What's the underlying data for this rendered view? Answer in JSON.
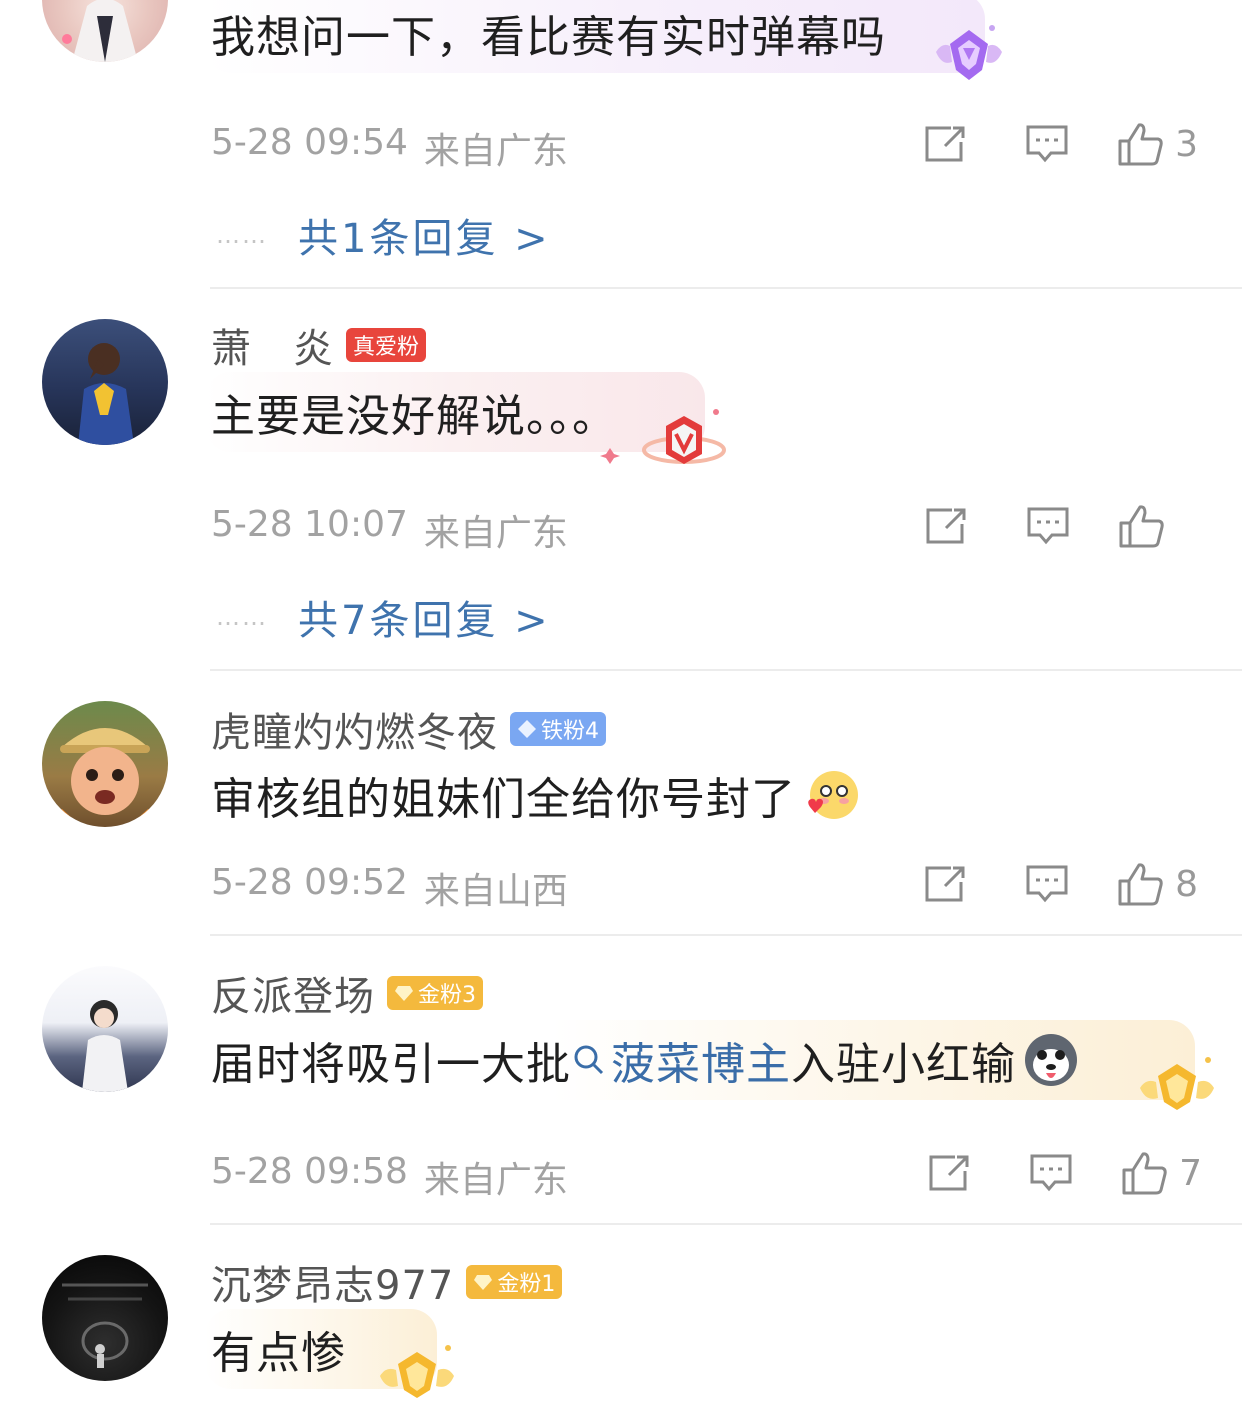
{
  "comments": [
    {
      "username": "",
      "badge": null,
      "content": "我想问一下，看比赛有实时弹幕吗",
      "time": "5-28 09:54",
      "location": "来自广东",
      "likes": "3",
      "replies": "共1条回复 >"
    },
    {
      "username": "萧　炎",
      "badge": {
        "label": "真爱粉",
        "color": "#e8453c"
      },
      "content": "主要是没好解说。。。",
      "time": "5-28 10:07",
      "location": "来自广东",
      "likes": "",
      "replies": "共7条回复 >"
    },
    {
      "username": "虎瞳灼灼燃冬夜",
      "badge": {
        "label": "铁粉4",
        "color": "#7aa7f2"
      },
      "content": "审核组的姐妹们全给你号封了",
      "time": "5-28 09:52",
      "location": "来自山西",
      "likes": "8",
      "replies": ""
    },
    {
      "username": "反派登场",
      "badge": {
        "label": "金粉3",
        "color": "#f4b93d"
      },
      "content_prefix": "届时将吸引一大批",
      "topic": "菠菜博主",
      "content_suffix": "入驻小红输",
      "time": "5-28 09:58",
      "location": "来自广东",
      "likes": "7",
      "replies": ""
    },
    {
      "username": "沉梦昂志977",
      "badge": {
        "label": "金粉1",
        "color": "#f4b93d"
      },
      "content": "有点惨",
      "time": "",
      "location": "",
      "likes": "",
      "replies": ""
    }
  ],
  "icons": {
    "share": "share-icon",
    "comment": "comment-icon",
    "like": "thumbs-up-icon",
    "search": "search-icon"
  }
}
